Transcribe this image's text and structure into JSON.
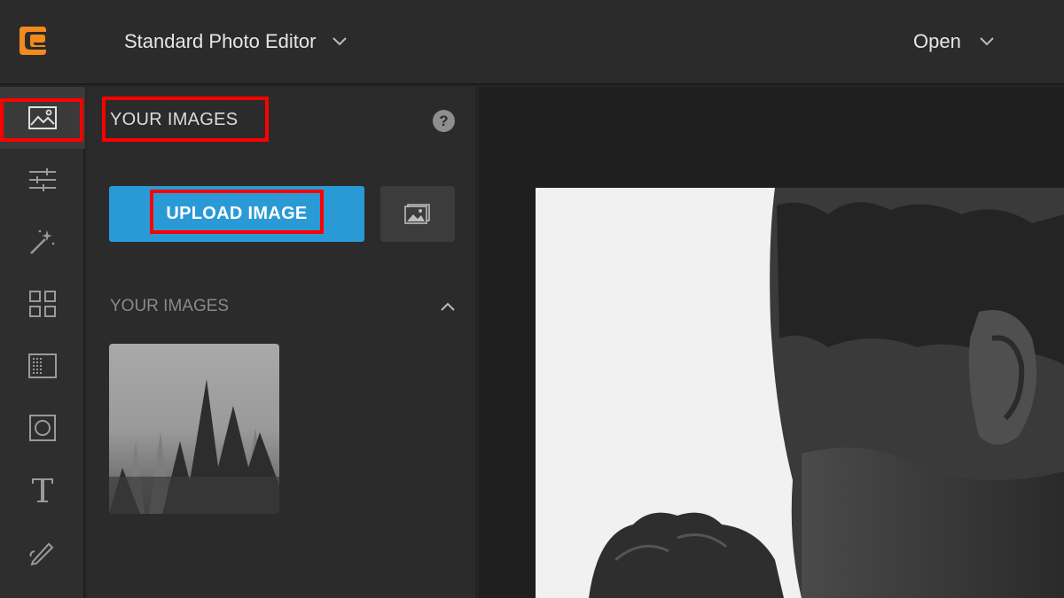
{
  "header": {
    "editor_mode": "Standard Photo Editor",
    "open_label": "Open"
  },
  "toolbar": {
    "items": [
      {
        "name": "images",
        "icon": "image-icon",
        "active": true
      },
      {
        "name": "adjustments",
        "icon": "sliders-icon"
      },
      {
        "name": "effects",
        "icon": "magic-wand-icon"
      },
      {
        "name": "overlays",
        "icon": "grid-icon"
      },
      {
        "name": "textures",
        "icon": "texture-icon"
      },
      {
        "name": "frames",
        "icon": "frame-icon"
      },
      {
        "name": "text",
        "icon": "text-icon"
      },
      {
        "name": "draw",
        "icon": "brush-icon"
      }
    ]
  },
  "panel": {
    "title": "YOUR IMAGES",
    "help": "?",
    "upload_label": "UPLOAD IMAGE",
    "section_title": "YOUR IMAGES"
  },
  "colors": {
    "accent": "#2a9ad6",
    "highlight": "#ff0000",
    "background": "#262626"
  }
}
